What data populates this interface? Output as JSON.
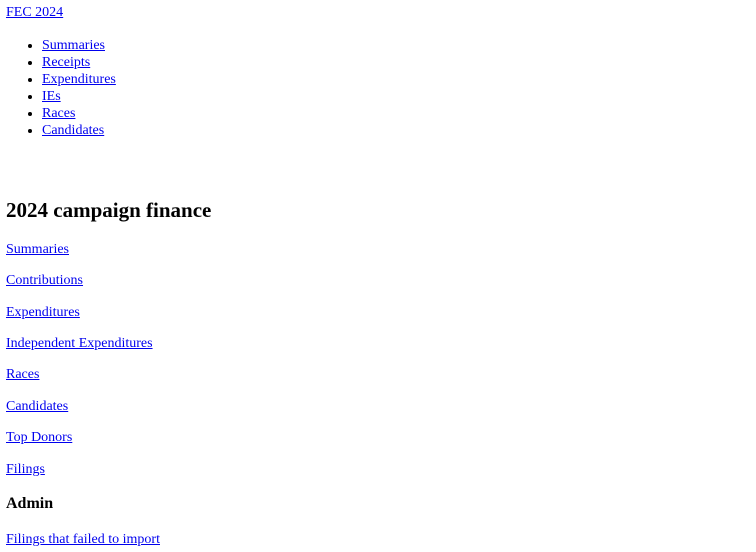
{
  "header": {
    "brand": "FEC 2024"
  },
  "nav": {
    "items": [
      {
        "label": "Summaries"
      },
      {
        "label": "Receipts"
      },
      {
        "label": "Expenditures"
      },
      {
        "label": "IEs"
      },
      {
        "label": "Races"
      },
      {
        "label": "Candidates"
      }
    ]
  },
  "main": {
    "title": "2024 campaign finance",
    "links": [
      {
        "label": "Summaries"
      },
      {
        "label": "Contributions"
      },
      {
        "label": "Expenditures"
      },
      {
        "label": "Independent Expenditures"
      },
      {
        "label": "Races"
      },
      {
        "label": "Candidates"
      },
      {
        "label": "Top Donors"
      },
      {
        "label": "Filings"
      }
    ],
    "admin": {
      "heading": "Admin",
      "links": [
        {
          "label": "Filings that failed to import"
        }
      ]
    }
  }
}
